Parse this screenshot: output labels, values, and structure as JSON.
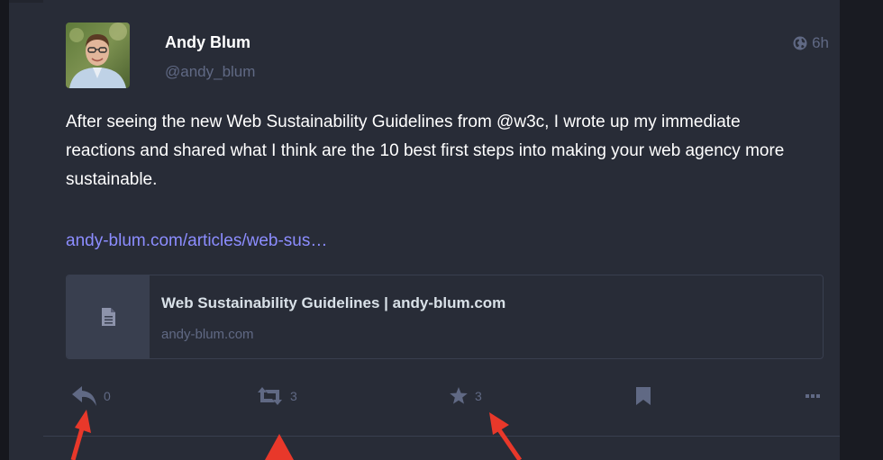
{
  "status": {
    "author": {
      "display_name": "Andy Blum",
      "handle": "@andy_blum",
      "avatar_icon": "avatar-photo"
    },
    "visibility_icon": "globe-icon",
    "relative_time": "6h",
    "content": [
      "After seeing the new Web Sustainability Guidelines from @w3c, I wrote up my immediate reactions and shared what I think are the 10 best first steps into making your web agency more sustainable."
    ],
    "link_text": "andy-blum.com/articles/web-sus…",
    "card": {
      "icon": "document-icon",
      "title": "Web Sustainability Guidelines | andy-blum.com",
      "domain": "andy-blum.com"
    },
    "actions": {
      "reply_count": "0",
      "boost_count": "3",
      "favourite_count": "3"
    }
  },
  "colors": {
    "column_bg": "#282c37",
    "page_bg": "#191b22",
    "muted_text": "#606984",
    "link": "#8c8dff",
    "annotation_arrow": "#e8382a"
  }
}
